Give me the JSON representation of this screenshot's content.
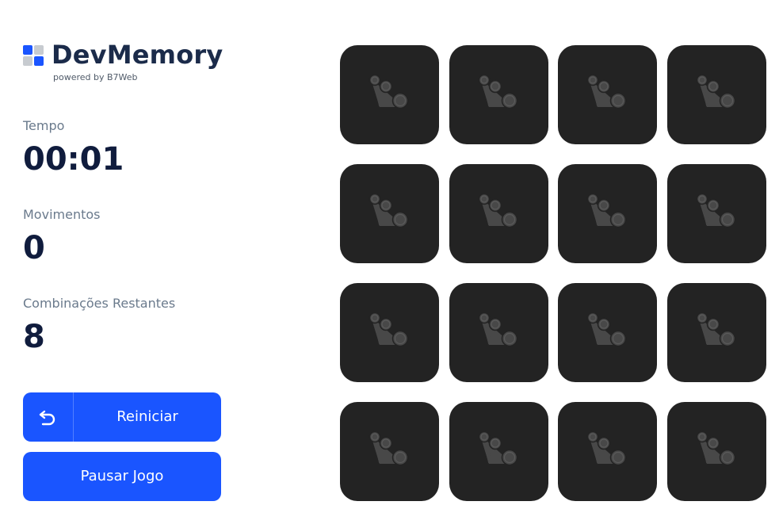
{
  "logo": {
    "title": "DevMemory",
    "subtitle": "powered by B7Web",
    "icon": "logo-squares-icon",
    "colors": [
      "#1a55ff",
      "#c7cbd0",
      "#c7cbd0",
      "#1a55ff"
    ]
  },
  "stats": [
    {
      "label": "Tempo",
      "value": "00:01"
    },
    {
      "label": "Movimentos",
      "value": "0"
    },
    {
      "label": "Combinações Restantes",
      "value": "8"
    }
  ],
  "buttons": {
    "restart": {
      "label": "Reiniciar",
      "icon": "restart-arrow-icon"
    },
    "pause": {
      "label": "Pausar Jogo"
    }
  },
  "board": {
    "rows": 4,
    "columns": 4,
    "card_icon": "b7web-logo-icon",
    "cards_face_down": 16
  },
  "colors": {
    "accent": "#1a55ff",
    "card_back": "#232323",
    "card_icon": "#484848",
    "title": "#1b2b4a",
    "stat_value": "#101c3d",
    "stat_label": "#6a7a8c"
  }
}
